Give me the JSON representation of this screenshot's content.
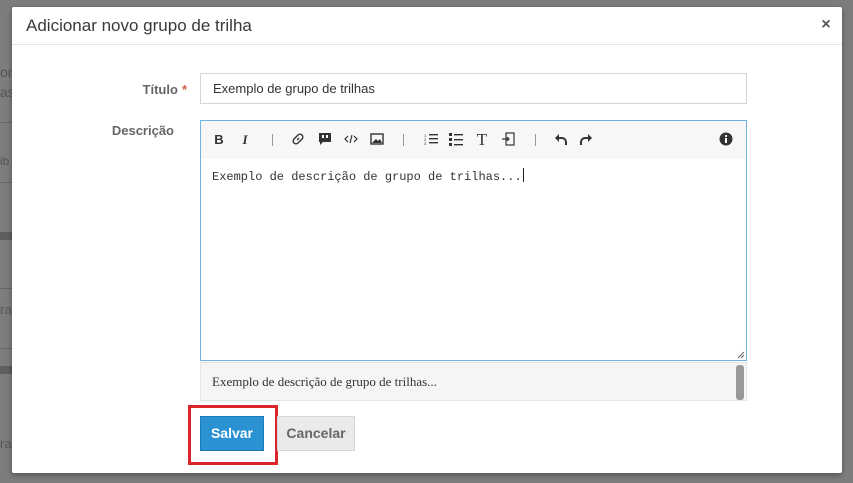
{
  "background": {
    "fragments": [
      "on",
      "as",
      "ib",
      "ra",
      "ra"
    ]
  },
  "modal": {
    "title": "Adicionar novo grupo de trilha",
    "close_icon": "close-icon"
  },
  "form": {
    "title_label": "Título",
    "required_mark": "*",
    "title_value": "Exemplo de grupo de trilhas",
    "description_label": "Descrição",
    "toolbar": {
      "bold": "B",
      "italic": "I",
      "text_style": "T",
      "icons": [
        "bold-icon",
        "italic-icon",
        "link-icon",
        "quote-icon",
        "code-icon",
        "image-icon",
        "ordered-list-icon",
        "unordered-list-icon",
        "text-style-icon",
        "indent-icon",
        "undo-icon",
        "redo-icon",
        "info-icon"
      ]
    },
    "description_value": "Exemplo de descrição de grupo de trilhas...",
    "preview_text": "Exemplo de descrição de grupo de trilhas..."
  },
  "actions": {
    "save_label": "Salvar",
    "cancel_label": "Cancelar"
  },
  "colors": {
    "primary": "#2a92d2",
    "required": "#d15b47",
    "highlight": "#d9262a",
    "editor_border": "#6fb3e0"
  }
}
